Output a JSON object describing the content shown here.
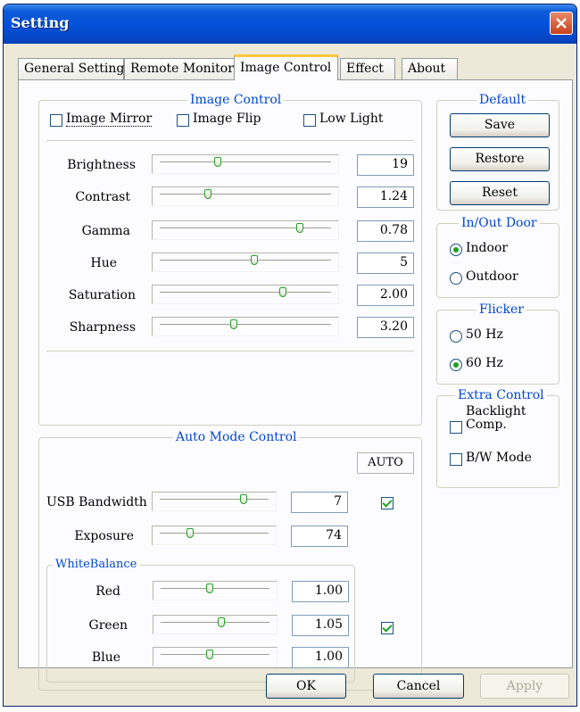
{
  "window": {
    "title": "Setting"
  },
  "tabs": [
    {
      "label": "General Setting"
    },
    {
      "label": "Remote Monitor"
    },
    {
      "label": "Image Control"
    },
    {
      "label": "Effect"
    },
    {
      "label": "About"
    }
  ],
  "image_control": {
    "title": "Image Control",
    "checkboxes": [
      {
        "label": "Image Mirror",
        "checked": false
      },
      {
        "label": "Image Flip",
        "checked": false
      },
      {
        "label": "Low Light",
        "checked": false
      }
    ],
    "sliders": [
      {
        "label": "Brightness",
        "value": "19",
        "position": 0.34
      },
      {
        "label": "Contrast",
        "value": "1.24",
        "position": 0.28
      },
      {
        "label": "Gamma",
        "value": "0.78",
        "position": 0.82
      },
      {
        "label": "Hue",
        "value": "5",
        "position": 0.55
      },
      {
        "label": "Saturation",
        "value": "2.00",
        "position": 0.72
      },
      {
        "label": "Sharpness",
        "value": "3.20",
        "position": 0.43
      }
    ]
  },
  "auto_mode": {
    "title": "Auto Mode Control",
    "auto_header": "AUTO",
    "usb_bandwidth": {
      "label": "USB Bandwidth",
      "value": "7",
      "position": 0.77,
      "auto": true
    },
    "exposure": {
      "label": "Exposure",
      "value": "74",
      "position": 0.28
    },
    "white_balance": {
      "title": "WhiteBalance",
      "auto": true,
      "channels": [
        {
          "label": "Red",
          "value": "1.00",
          "position": 0.45
        },
        {
          "label": "Green",
          "value": "1.05",
          "position": 0.56
        },
        {
          "label": "Blue",
          "value": "1.00",
          "position": 0.45
        }
      ]
    }
  },
  "default_group": {
    "title": "Default",
    "buttons": [
      {
        "label": "Save"
      },
      {
        "label": "Restore"
      },
      {
        "label": "Reset"
      }
    ]
  },
  "inout_door": {
    "title": "In/Out Door",
    "options": [
      {
        "label": "Indoor",
        "selected": true
      },
      {
        "label": "Outdoor",
        "selected": false
      }
    ]
  },
  "flicker": {
    "title": "Flicker",
    "options": [
      {
        "label": "50 Hz",
        "selected": false
      },
      {
        "label": "60 Hz",
        "selected": true
      }
    ]
  },
  "extra_control": {
    "title": "Extra Control",
    "backlight_line1": "Backlight",
    "backlight_line2": "Comp.",
    "backlight_checked": false,
    "bw_label": "B/W Mode",
    "bw_checked": false
  },
  "footer": {
    "ok": "OK",
    "cancel": "Cancel",
    "apply": "Apply"
  },
  "colors": {
    "titlebar": "#0351d9",
    "group_title": "#0046d5",
    "check_mark": "#21a121",
    "tab_highlight": "#ffc83c"
  }
}
